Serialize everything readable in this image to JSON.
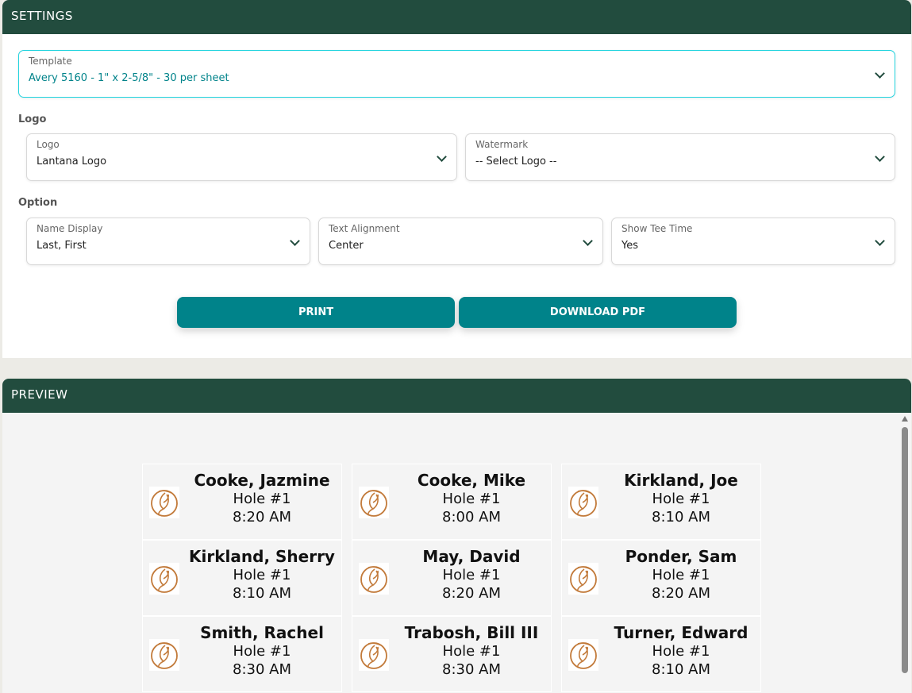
{
  "settings": {
    "title": "SETTINGS",
    "template": {
      "label": "Template",
      "value": "Avery 5160 - 1\" x 2-5/8\" - 30 per sheet"
    },
    "logo_section": "Logo",
    "logo": {
      "label": "Logo",
      "value": "Lantana Logo"
    },
    "watermark": {
      "label": "Watermark",
      "value": "-- Select Logo --"
    },
    "option_section": "Option",
    "name_display": {
      "label": "Name Display",
      "value": "Last, First"
    },
    "text_alignment": {
      "label": "Text Alignment",
      "value": "Center"
    },
    "show_tee_time": {
      "label": "Show Tee Time",
      "value": "Yes"
    },
    "print_label": "PRINT",
    "download_label": "DOWNLOAD PDF"
  },
  "preview": {
    "title": "PREVIEW",
    "labels": [
      {
        "name": "Cooke, Jazmine",
        "hole": "Hole #1",
        "time": "8:20 AM"
      },
      {
        "name": "Cooke, Mike",
        "hole": "Hole #1",
        "time": "8:00 AM"
      },
      {
        "name": "Kirkland, Joe",
        "hole": "Hole #1",
        "time": "8:10 AM"
      },
      {
        "name": "Kirkland, Sherry",
        "hole": "Hole #1",
        "time": "8:10 AM"
      },
      {
        "name": "May, David",
        "hole": "Hole #1",
        "time": "8:20 AM"
      },
      {
        "name": "Ponder, Sam",
        "hole": "Hole #1",
        "time": "8:20 AM"
      },
      {
        "name": "Smith, Rachel",
        "hole": "Hole #1",
        "time": "8:30 AM"
      },
      {
        "name": "Trabosh, Bill III",
        "hole": "Hole #1",
        "time": "8:30 AM"
      },
      {
        "name": "Turner, Edward",
        "hole": "Hole #1",
        "time": "8:10 AM"
      }
    ]
  },
  "colors": {
    "header": "#224c3e",
    "accent": "#00838a",
    "logo": "#c27a3a"
  }
}
